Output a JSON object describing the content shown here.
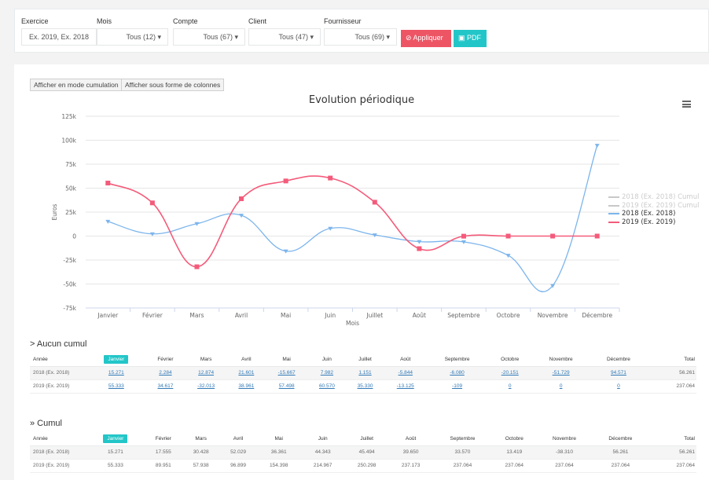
{
  "filters": [
    {
      "label": "Exercice",
      "value": "Ex. 2019, Ex. 2018"
    },
    {
      "label": "Mois",
      "value": "Tous (12) ▾"
    },
    {
      "label": "Compte",
      "value": "Tous (67) ▾"
    },
    {
      "label": "Client",
      "value": "Tous (47) ▾"
    },
    {
      "label": "Fournisseur",
      "value": "Tous (69) ▾"
    }
  ],
  "buttons": {
    "apply": "⊘ Appliquer",
    "pdf": "▣ PDF",
    "cumul_mode": "Afficher en mode cumulation",
    "columns_mode": "Afficher sous forme de colonnes"
  },
  "chart_data": {
    "type": "line",
    "title": "Evolution périodique",
    "xlabel": "Mois",
    "ylabel": "Euros",
    "categories": [
      "Janvier",
      "Février",
      "Mars",
      "Avril",
      "Mai",
      "Juin",
      "Juillet",
      "Août",
      "Septembre",
      "Octobre",
      "Novembre",
      "Décembre"
    ],
    "yticks": [
      "125k",
      "100k",
      "75k",
      "50k",
      "25k",
      "0",
      "-25k",
      "-50k",
      "-75k"
    ],
    "ylim": [
      -75000,
      125000
    ],
    "series": [
      {
        "name": "2018 (Ex. 2018) Cumul",
        "color": "#c8c8c8",
        "visible": false,
        "values": []
      },
      {
        "name": "2019 (Ex. 2019) Cumul",
        "color": "#c8c8c8",
        "visible": false,
        "values": []
      },
      {
        "name": "2018 (Ex. 2018)",
        "color": "#7cb5ec",
        "visible": true,
        "values": [
          15271,
          2284,
          12874,
          21601,
          -15667,
          7982,
          1151,
          -5844,
          -6080,
          -20151,
          -51729,
          94571
        ]
      },
      {
        "name": "2019 (Ex. 2019)",
        "color": "#f45b7a",
        "visible": true,
        "values": [
          55333,
          34617,
          -32013,
          38961,
          57498,
          60570,
          35330,
          -13125,
          -109,
          0,
          0,
          0
        ]
      }
    ],
    "legend": "right"
  },
  "tables": {
    "aucun": {
      "title": "> Aucun cumul",
      "headers": [
        "Année",
        "Janvier",
        "Février",
        "Mars",
        "Avril",
        "Mai",
        "Juin",
        "Juillet",
        "Août",
        "Septembre",
        "Octobre",
        "Novembre",
        "Décembre",
        "Total"
      ],
      "rows": [
        [
          "2018 (Ex. 2018)",
          "15.271",
          "2.284",
          "12.874",
          "21.601",
          "-15.667",
          "7.982",
          "1.151",
          "-5.844",
          "-6.080",
          "-20.151",
          "-51.729",
          "94.571",
          "56.261"
        ],
        [
          "2019 (Ex. 2019)",
          "55.333",
          "34.617",
          "-32.013",
          "38.961",
          "57.498",
          "60.570",
          "35.330",
          "-13.125",
          "-109",
          "0",
          "0",
          "0",
          "237.064"
        ]
      ]
    },
    "cumul": {
      "title": "» Cumul",
      "headers": [
        "Année",
        "Janvier",
        "Février",
        "Mars",
        "Avril",
        "Mai",
        "Juin",
        "Juillet",
        "Août",
        "Septembre",
        "Octobre",
        "Novembre",
        "Décembre",
        "Total"
      ],
      "rows": [
        [
          "2018 (Ex. 2018)",
          "15.271",
          "17.555",
          "30.428",
          "52.029",
          "36.361",
          "44.343",
          "45.494",
          "39.650",
          "33.570",
          "13.419",
          "-38.310",
          "56.261",
          "56.261"
        ],
        [
          "2019 (Ex. 2019)",
          "55.333",
          "89.951",
          "57.938",
          "96.899",
          "154.398",
          "214.967",
          "250.298",
          "237.173",
          "237.064",
          "237.064",
          "237.064",
          "237.064",
          "237.064"
        ]
      ]
    }
  }
}
